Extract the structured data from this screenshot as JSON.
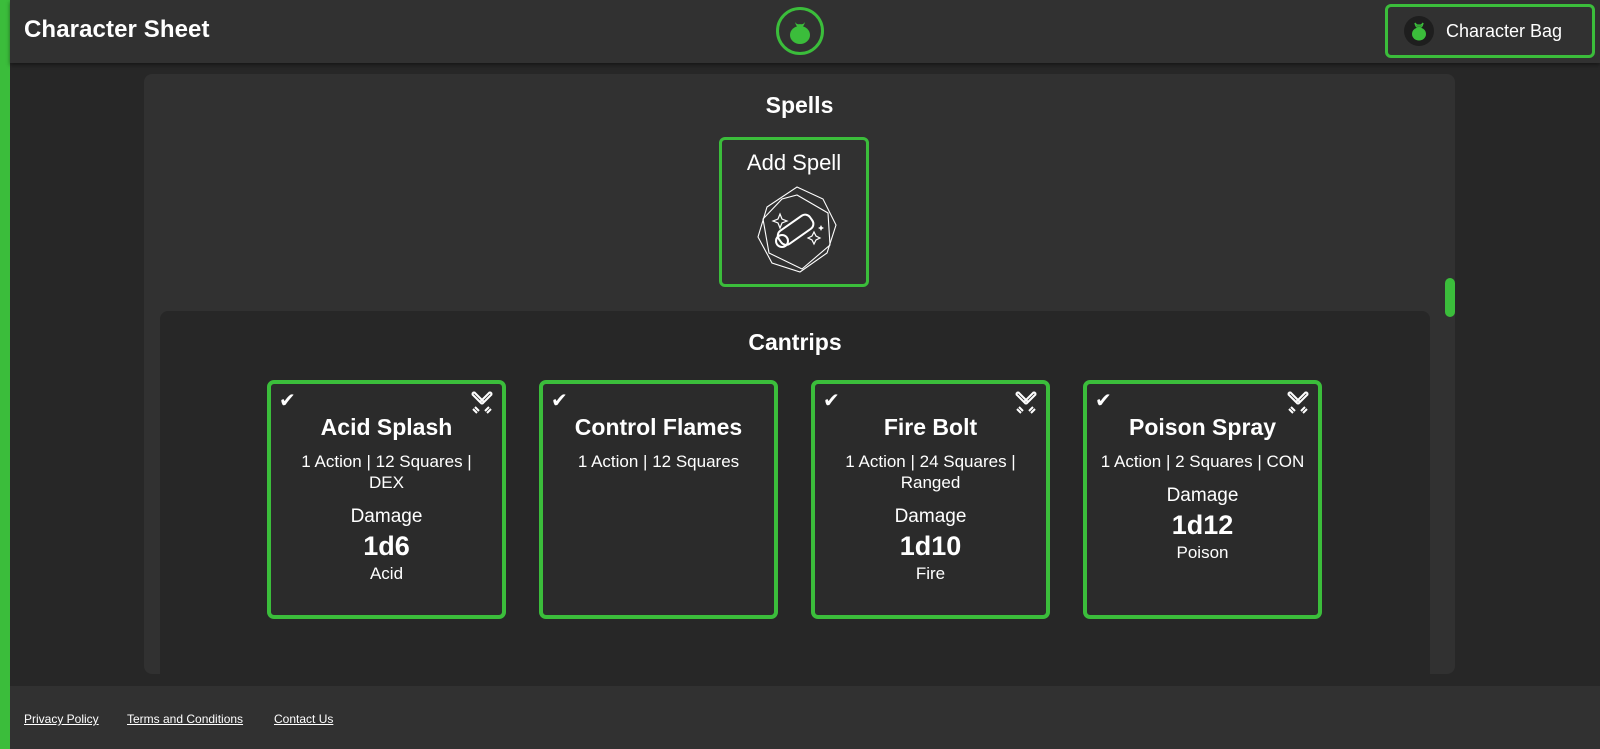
{
  "header": {
    "title": "Character Sheet",
    "logo_icon": "apple-bag-icon",
    "bag_button_label": "Character Bag",
    "bag_icon": "bag-icon"
  },
  "spells": {
    "title": "Spells",
    "add_spell_label": "Add Spell",
    "add_spell_icon": "scroll-sparkle-icon"
  },
  "cantrips": {
    "title": "Cantrips",
    "cards": [
      {
        "name": "Acid Splash",
        "meta": "1 Action | 12 Squares | DEX",
        "damage_label": "Damage",
        "damage_value": "1d6",
        "damage_type": "Acid",
        "checked": true,
        "attack_icon": "crossed-swords-icon"
      },
      {
        "name": "Control Flames",
        "meta": "1 Action | 12 Squares",
        "checked": true
      },
      {
        "name": "Fire Bolt",
        "meta": "1 Action | 24 Squares | Ranged",
        "damage_label": "Damage",
        "damage_value": "1d10",
        "damage_type": "Fire",
        "checked": true,
        "attack_icon": "crossed-swords-icon"
      },
      {
        "name": "Poison Spray",
        "meta": "1 Action | 2 Squares | CON",
        "damage_label": "Damage",
        "damage_value": "1d12",
        "damage_type": "Poison",
        "checked": true,
        "attack_icon": "crossed-swords-icon"
      }
    ]
  },
  "footer": {
    "privacy": "Privacy Policy",
    "terms": "Terms and Conditions",
    "contact": "Contact Us"
  },
  "colors": {
    "accent": "#3bbd3b",
    "background": "#272727",
    "panel": "#313131"
  }
}
